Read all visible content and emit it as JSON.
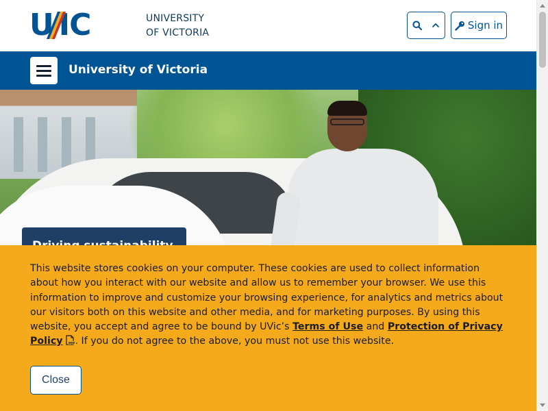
{
  "header": {
    "logo_text": "UVIC",
    "university_line1": "UNIVERSITY",
    "university_line2": "OF VICTORIA",
    "signin_label": "Sign in"
  },
  "navbar": {
    "site_title": "University of Victoria"
  },
  "hero": {
    "caption": "Driving sustainability"
  },
  "cookie_banner": {
    "text_before": "This website stores cookies on your computer. These cookies are used to collect information about how you interact with our website and allow us to remember your browser. We use this information to improve and customize your browsing experience, for analytics and metrics about our visitors both on this website and other media, and for marketing purposes. By using this website, you accept and agree to be bound by UVic’s ",
    "terms_link": "Terms of Use",
    "and_text": " and ",
    "privacy_link": "Protection of Privacy Policy",
    "text_after": ". If you do not agree to the above, you must not use this website.",
    "close_label": "Close"
  },
  "colors": {
    "brand_blue": "#005493",
    "banner_yellow": "#f5aa1c",
    "caption_navy": "#1f3f66"
  },
  "icons": {
    "search": "search-icon",
    "chevron": "chevron-up-icon",
    "signin": "key-icon",
    "menu": "hamburger-icon",
    "pdf": "pdf-icon"
  }
}
